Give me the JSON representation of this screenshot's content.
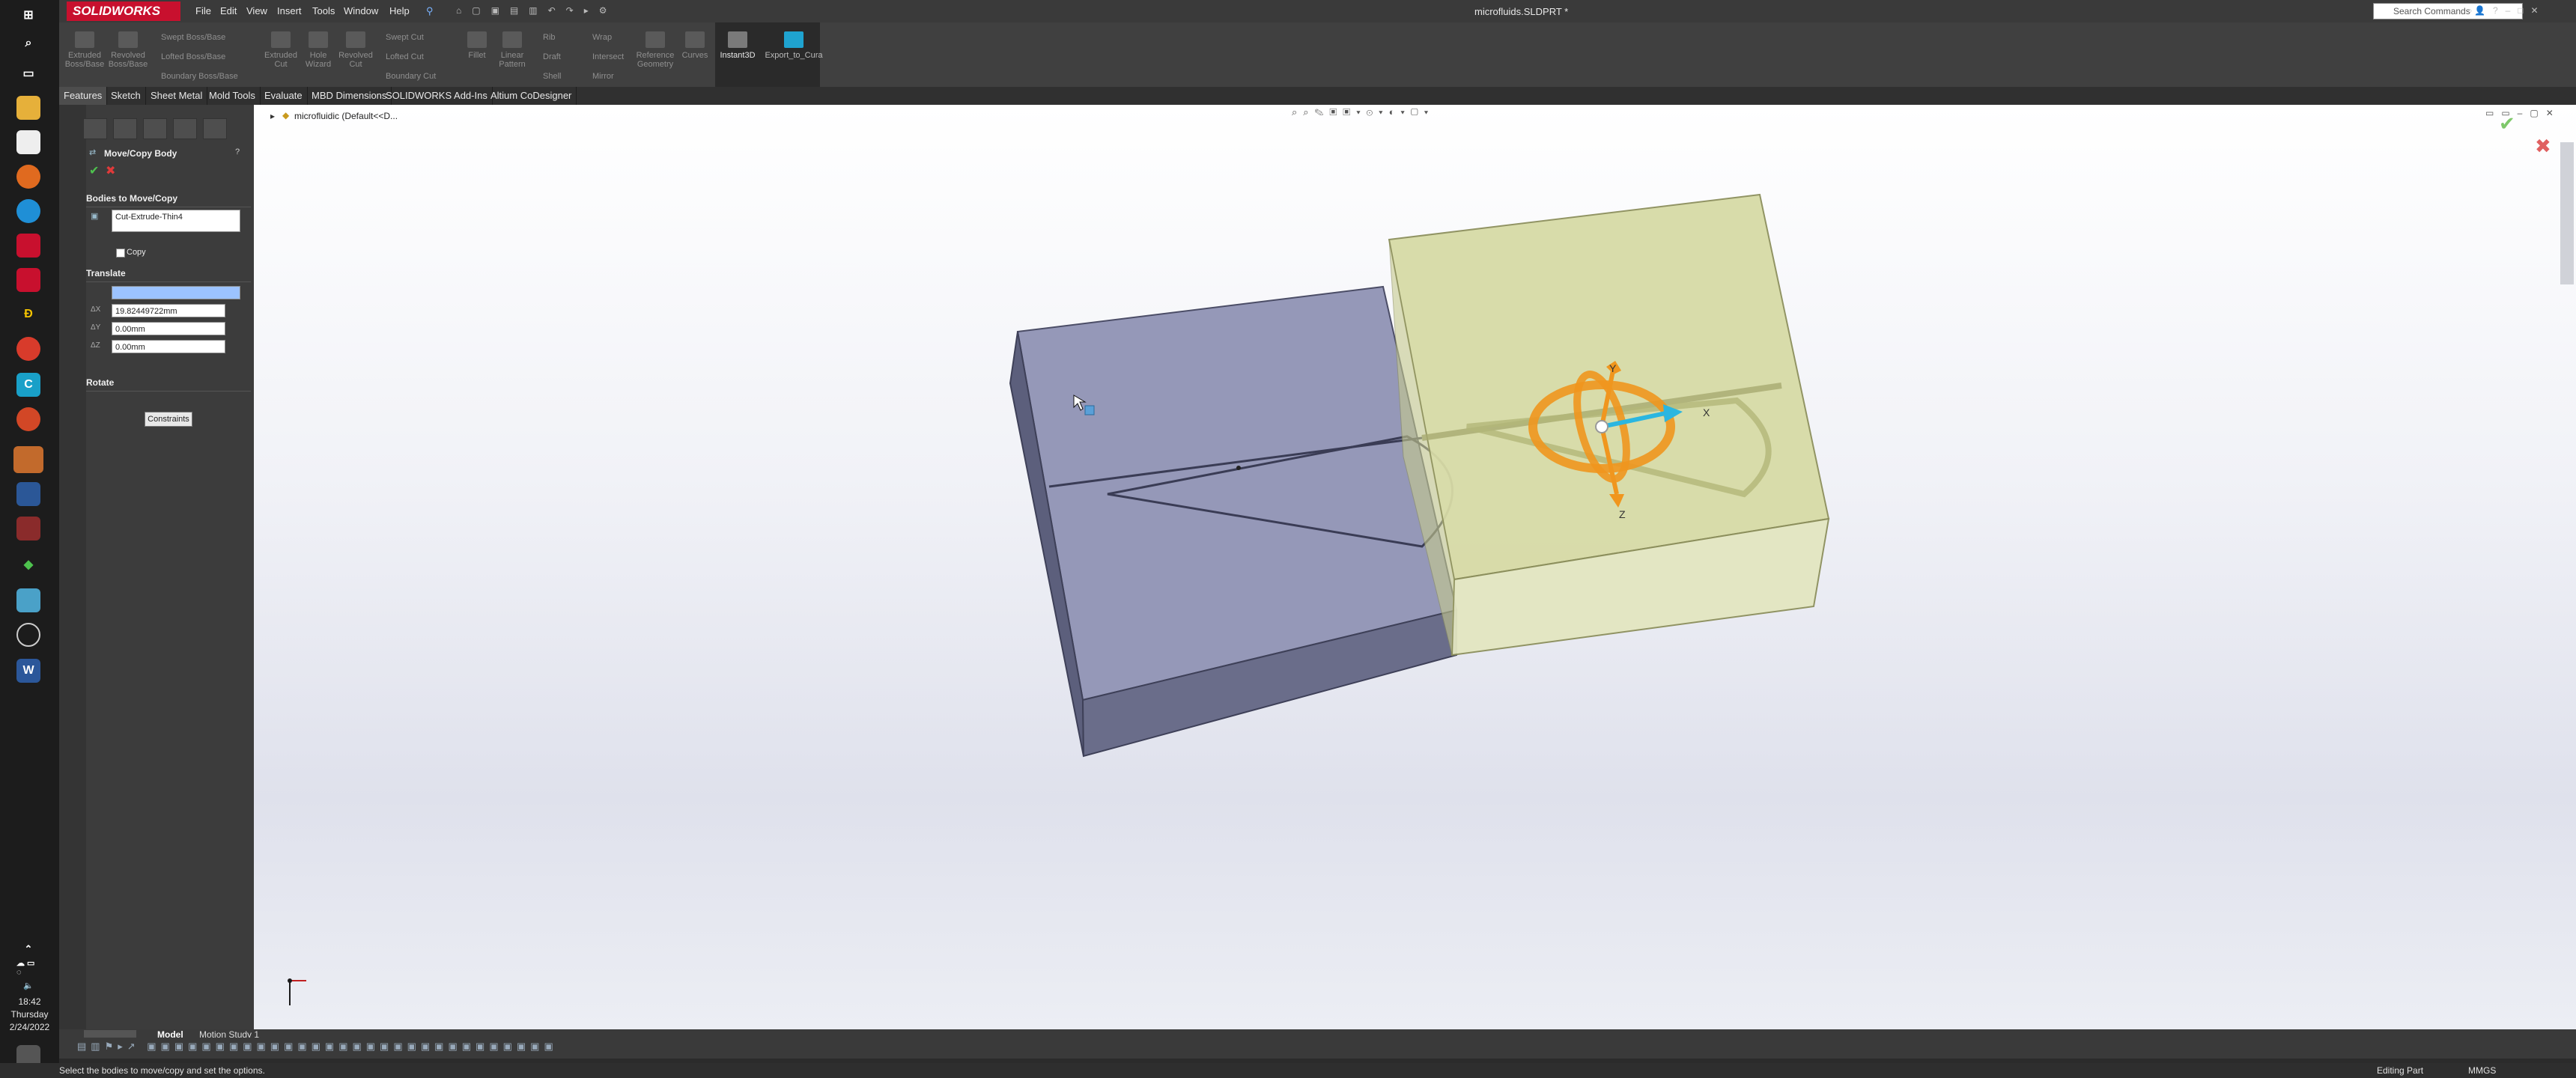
{
  "taskbar": {
    "clock_time": "18:42",
    "clock_day": "Thursday",
    "clock_date": "2/24/2022"
  },
  "menubar": {
    "logo": "SOLIDWORKS",
    "menus": [
      "File",
      "Edit",
      "View",
      "Insert",
      "Tools",
      "Window",
      "Help"
    ],
    "doc_title": "microfluids.SLDPRT *",
    "search_placeholder": "Search Commands"
  },
  "ribbon": {
    "buttons": [
      {
        "label1": "Extruded",
        "label2": "Boss/Base"
      },
      {
        "label1": "Revolved",
        "label2": "Boss/Base"
      },
      {
        "label1": "Extruded",
        "label2": "Cut"
      },
      {
        "label1": "Hole",
        "label2": "Wizard"
      },
      {
        "label1": "Revolved",
        "label2": "Cut"
      },
      {
        "label1": "Fillet",
        "label2": ""
      },
      {
        "label1": "Linear",
        "label2": "Pattern"
      },
      {
        "label1": "Reference",
        "label2": "Geometry"
      },
      {
        "label1": "Curves",
        "label2": ""
      },
      {
        "label1": "Instant3D",
        "label2": ""
      },
      {
        "label1": "Export_to_Cura",
        "label2": ""
      }
    ],
    "small": {
      "swept_boss": "Swept Boss/Base",
      "lofted_boss": "Lofted Boss/Base",
      "boundary_boss": "Boundary Boss/Base",
      "swept_cut": "Swept Cut",
      "lofted_cut": "Lofted Cut",
      "boundary_cut": "Boundary Cut",
      "rib": "Rib",
      "draft": "Draft",
      "shell": "Shell",
      "wrap": "Wrap",
      "intersect": "Intersect",
      "mirror": "Mirror"
    }
  },
  "tabs": [
    "Features",
    "Sketch",
    "Sheet Metal",
    "Mold Tools",
    "Evaluate",
    "MBD Dimensions",
    "SOLIDWORKS Add-Ins",
    "Altium CoDesigner"
  ],
  "pm": {
    "title": "Move/Copy Body",
    "bodies_group": "Bodies to Move/Copy",
    "body_item": "Cut-Extrude-Thin4",
    "copy_label": "Copy",
    "translate_group": "Translate",
    "dx": "19.82449722mm",
    "dy": "0.00mm",
    "dz": "0.00mm",
    "rotate_group": "Rotate",
    "constraints_button": "Constraints"
  },
  "feature_tree": {
    "root": "microfluidic (Default<<D..."
  },
  "triad": {
    "x": "X",
    "y": "Y",
    "z": "Z"
  },
  "bottom_tabs": [
    "Model",
    "Motion Study 1"
  ],
  "status": {
    "message": "Select the bodies to move/copy and set the options.",
    "mode": "Editing Part",
    "units": "MMGS"
  },
  "colors": {
    "accent": "#c8102e",
    "body_blue": "#8e91b0",
    "body_yellow": "#d8dca8",
    "triad_orange": "#f0961e",
    "triad_cyan": "#2bb6e0"
  }
}
